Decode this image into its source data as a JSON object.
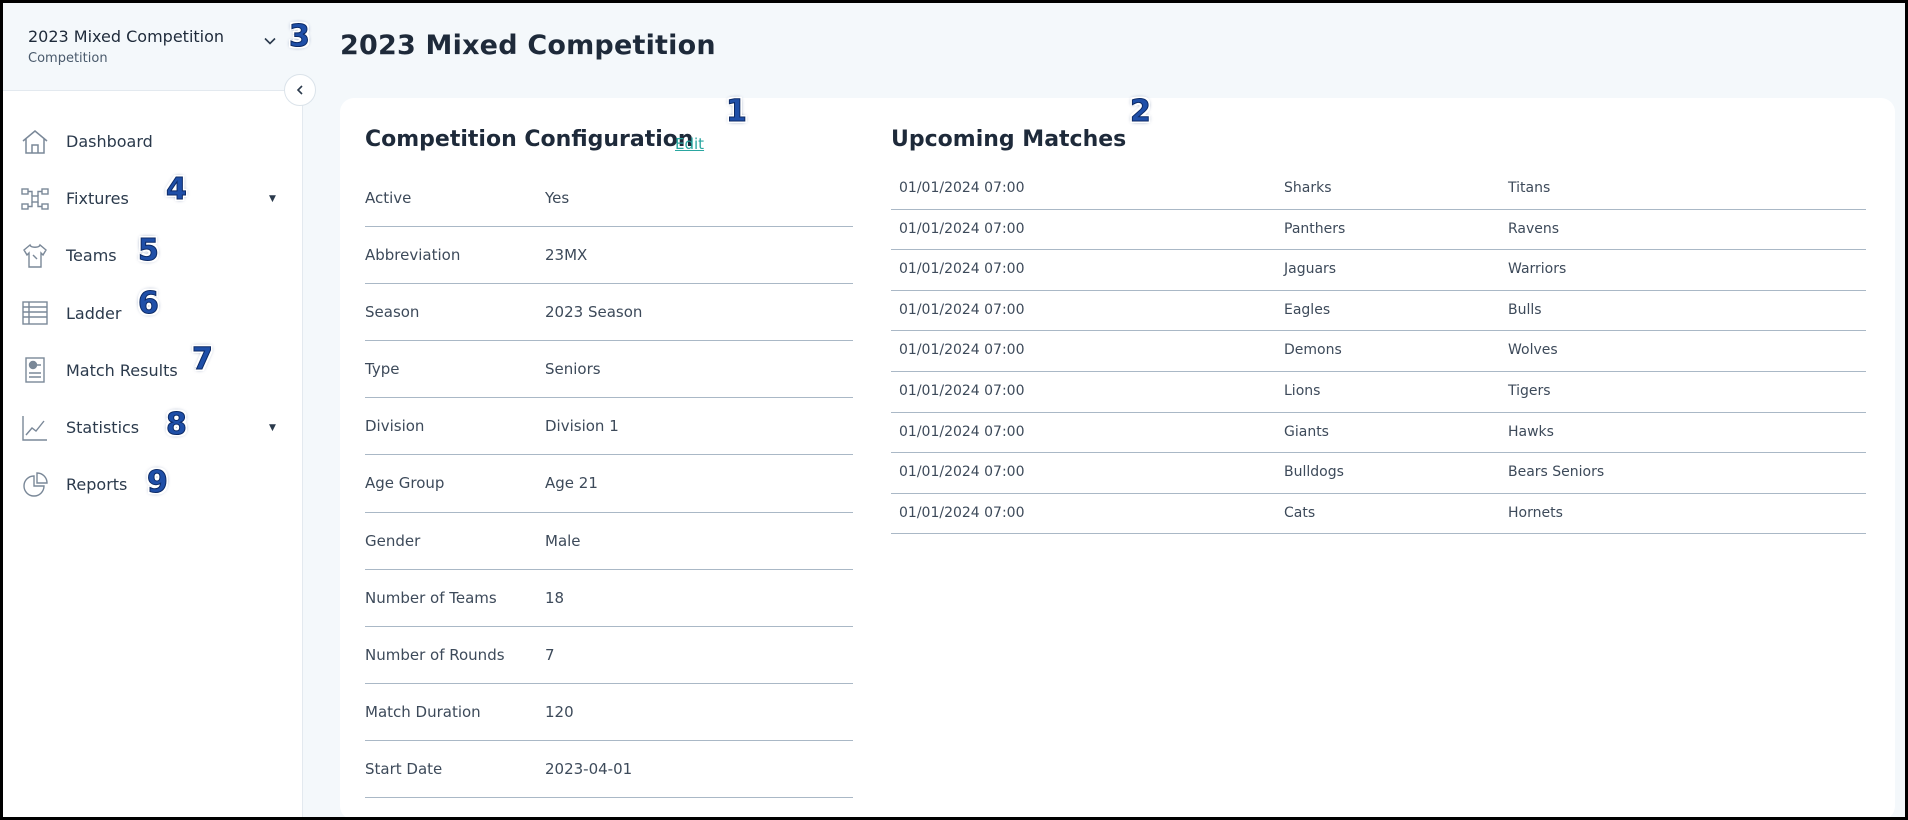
{
  "competition_switcher": {
    "name": "2023 Mixed Competition",
    "subtitle": "Competition"
  },
  "sidebar": {
    "items": [
      {
        "label": "Dashboard",
        "icon": "home-icon"
      },
      {
        "label": "Fixtures",
        "icon": "fixtures-icon",
        "has_caret": true
      },
      {
        "label": "Teams",
        "icon": "jersey-icon"
      },
      {
        "label": "Ladder",
        "icon": "ladder-table-icon"
      },
      {
        "label": "Match Results",
        "icon": "match-results-icon"
      },
      {
        "label": "Statistics",
        "icon": "statistics-chart-icon",
        "has_caret": true
      },
      {
        "label": "Reports",
        "icon": "pie-chart-icon"
      }
    ]
  },
  "page": {
    "title": "2023 Mixed Competition"
  },
  "configuration": {
    "title": "Competition Configuration",
    "edit_label": "Edit",
    "rows": [
      {
        "label": "Active",
        "value": "Yes"
      },
      {
        "label": "Abbreviation",
        "value": "23MX"
      },
      {
        "label": "Season",
        "value": "2023 Season"
      },
      {
        "label": "Type",
        "value": "Seniors"
      },
      {
        "label": "Division",
        "value": "Division 1"
      },
      {
        "label": "Age Group",
        "value": "Age 21"
      },
      {
        "label": "Gender",
        "value": "Male"
      },
      {
        "label": "Number of Teams",
        "value": "18"
      },
      {
        "label": "Number of Rounds",
        "value": "7"
      },
      {
        "label": "Match Duration",
        "value": "120"
      },
      {
        "label": "Start Date",
        "value": "2023-04-01"
      }
    ]
  },
  "upcoming_matches": {
    "title": "Upcoming Matches",
    "rows": [
      {
        "date": "01/01/2024 07:00",
        "home": "Sharks",
        "away": "Titans"
      },
      {
        "date": "01/01/2024 07:00",
        "home": "Panthers",
        "away": "Ravens"
      },
      {
        "date": "01/01/2024 07:00",
        "home": "Jaguars",
        "away": "Warriors"
      },
      {
        "date": "01/01/2024 07:00",
        "home": "Eagles",
        "away": "Bulls"
      },
      {
        "date": "01/01/2024 07:00",
        "home": "Demons",
        "away": "Wolves"
      },
      {
        "date": "01/01/2024 07:00",
        "home": "Lions",
        "away": "Tigers"
      },
      {
        "date": "01/01/2024 07:00",
        "home": "Giants",
        "away": "Hawks"
      },
      {
        "date": "01/01/2024 07:00",
        "home": "Bulldogs",
        "away": "Bears Seniors"
      },
      {
        "date": "01/01/2024 07:00",
        "home": "Cats",
        "away": "Hornets"
      }
    ]
  },
  "callouts": [
    "1",
    "2",
    "3",
    "4",
    "5",
    "6",
    "7",
    "8",
    "9"
  ],
  "colors": {
    "accent_link": "#2aa6a0",
    "callout": "#1f4fa8",
    "background": "#f4f8fb"
  }
}
